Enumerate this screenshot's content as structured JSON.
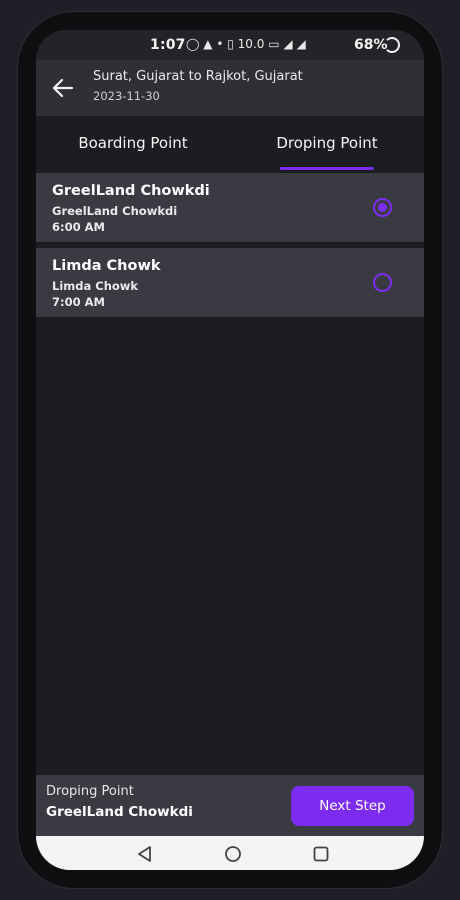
{
  "status_bar": {
    "time": "1:07",
    "icons": [
      "whatsapp-icon",
      "app-icon",
      "dot-icon",
      "vibrate-icon",
      "data-speed-icon",
      "volte-icon",
      "signal-5g-icon",
      "signal-icon"
    ],
    "speed_text": "10.0",
    "battery": "68%"
  },
  "header": {
    "route": "Surat, Gujarat  to  Rajkot, Gujarat",
    "date": "2023-11-30"
  },
  "tabs": [
    {
      "label": "Boarding Point",
      "active": false
    },
    {
      "label": "Droping Point",
      "active": true
    }
  ],
  "points": [
    {
      "name": "GreelLand Chowkdi",
      "address": "GreelLand Chowkdi",
      "time": "6:00 AM",
      "selected": true
    },
    {
      "name": "Limda Chowk",
      "address": "Limda Chowk",
      "time": "7:00 AM",
      "selected": false
    }
  ],
  "footer": {
    "label": "Droping Point",
    "value": "GreelLand Chowkdi",
    "button_label": "Next Step"
  },
  "colors": {
    "accent": "#7c2cf1",
    "background": "#1c1d21",
    "card": "#3a3b42",
    "appbar": "#2f3036"
  }
}
